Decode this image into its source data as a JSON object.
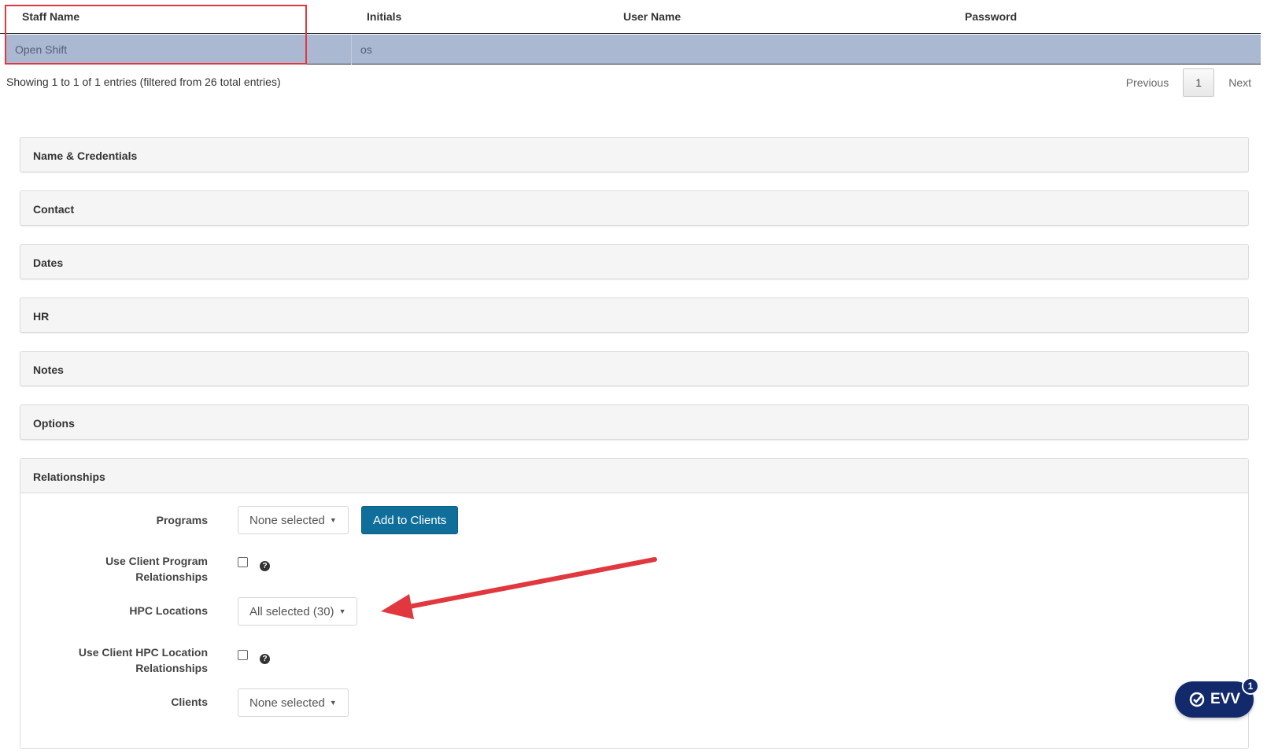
{
  "table": {
    "headers": [
      "Staff Name",
      "Initials",
      "User Name",
      "Password"
    ],
    "rows": [
      {
        "staff_name": "Open Shift",
        "initials": "os",
        "user_name": "",
        "password": ""
      }
    ],
    "info": "Showing 1 to 1 of 1 entries (filtered from 26 total entries)",
    "pager": {
      "previous": "Previous",
      "page": "1",
      "next": "Next"
    }
  },
  "panels": [
    "Name & Credentials",
    "Contact",
    "Dates",
    "HR",
    "Notes",
    "Options"
  ],
  "relationships": {
    "title": "Relationships",
    "programs_label": "Programs",
    "programs_value": "None selected",
    "add_to_clients": "Add to Clients",
    "use_client_program_label_1": "Use Client Program",
    "use_client_program_label_2": "Relationships",
    "hpc_locations_label": "HPC Locations",
    "hpc_locations_value": "All selected (30)",
    "use_client_hpc_label_1": "Use Client HPC Location",
    "use_client_hpc_label_2": "Relationships",
    "clients_label": "Clients",
    "clients_value": "None selected",
    "help_glyph": "?"
  },
  "evv": {
    "label": "EVV",
    "count": "1",
    "icon": "check-badge-icon"
  },
  "colors": {
    "selected_row": "#abb8d2",
    "primary_button": "#0f6f9a",
    "annotation": "#e0383e",
    "evv": "#122a6b"
  }
}
